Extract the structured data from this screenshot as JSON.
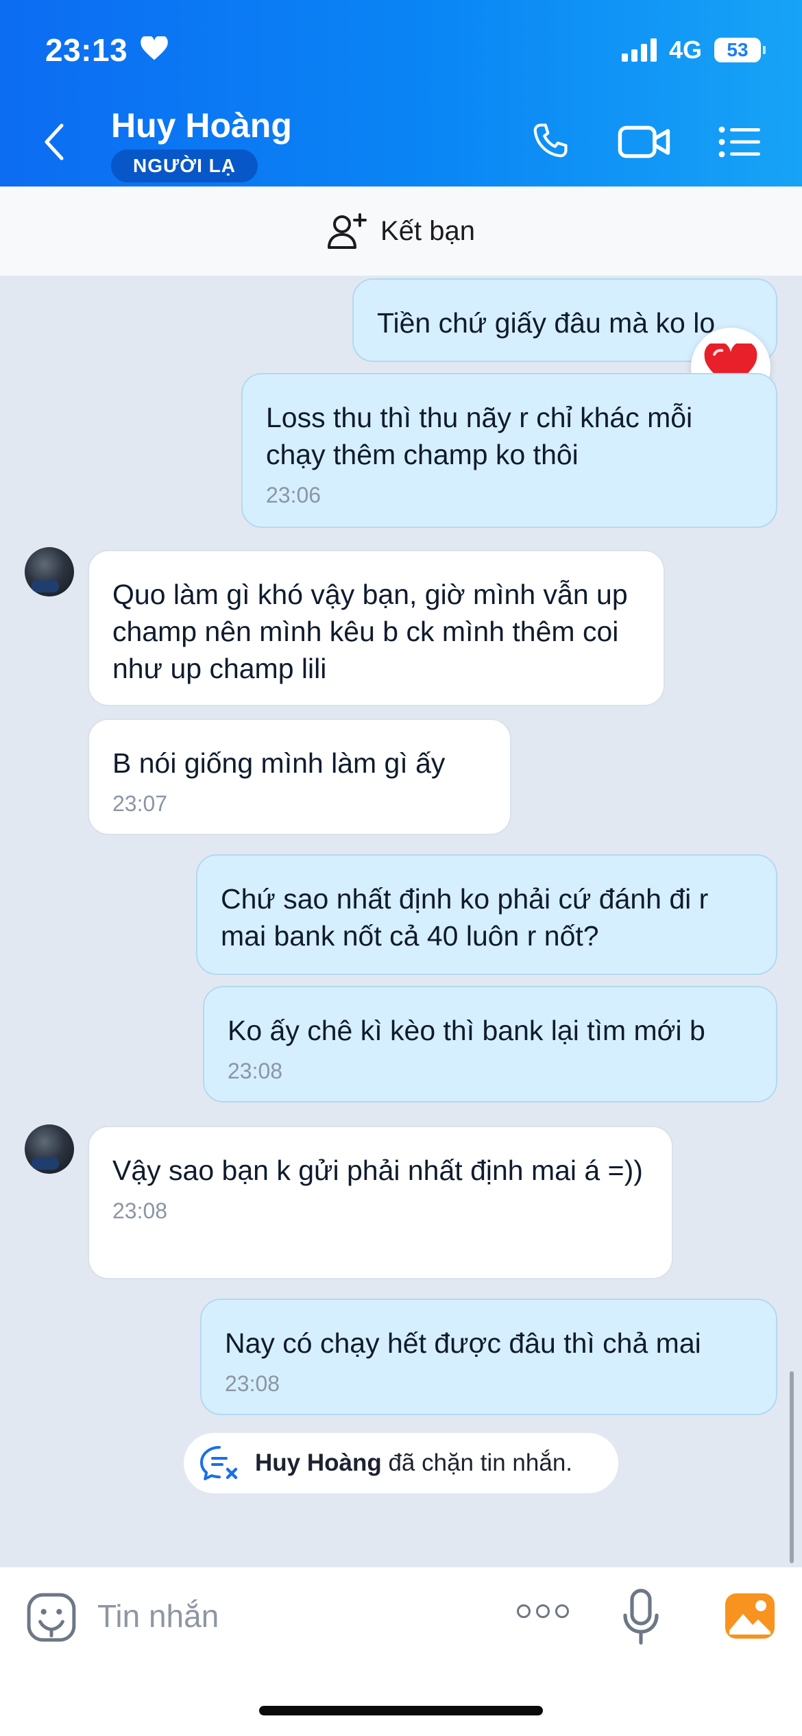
{
  "status_bar": {
    "time": "23:13",
    "network": "4G",
    "battery": "53"
  },
  "header": {
    "contact_name": "Huy Hoàng",
    "badge": "NGƯỜI LẠ"
  },
  "add_friend": {
    "label": "Kết bạn"
  },
  "messages": [
    {
      "sender": "me",
      "text": "Tiền chứ giấy đâu mà ko lo",
      "time": ""
    },
    {
      "sender": "me",
      "text": "Loss thu thì thu nãy r chỉ khác mỗi chạy thêm champ ko thôi",
      "time": "23:06"
    },
    {
      "sender": "them",
      "text": "Quo làm gì khó vậy bạn, giờ mình vẫn up champ nên mình kêu b ck mình thêm coi như up champ lili",
      "time": ""
    },
    {
      "sender": "them",
      "text": "B nói giống mình làm gì ấy",
      "time": "23:07"
    },
    {
      "sender": "me",
      "text": "Chứ sao nhất định ko phải cứ đánh đi r mai bank nốt cả 40 luôn r nốt?",
      "time": ""
    },
    {
      "sender": "me",
      "text": "Ko ấy chê kì kèo thì bank lại tìm mới b",
      "time": "23:08"
    },
    {
      "sender": "them",
      "text": "Vậy sao bạn k gửi phải nhất định mai á =))",
      "time": "23:08"
    },
    {
      "sender": "me",
      "text": "Nay có chạy hết được đâu thì chả mai",
      "time": "23:08"
    }
  ],
  "reaction": {
    "emoji": "heart",
    "color": "#e8202a"
  },
  "blocked_notice": {
    "name": "Huy Hoàng",
    "text": " đã chặn tin nhắn."
  },
  "input": {
    "placeholder": "Tin nhắn"
  },
  "colors": {
    "header_start": "#0c6cf2",
    "header_end": "#17a3f6",
    "bubble_mine": "#d6efff",
    "bubble_theirs": "#ffffff",
    "chat_bg": "#e2e8f1"
  }
}
